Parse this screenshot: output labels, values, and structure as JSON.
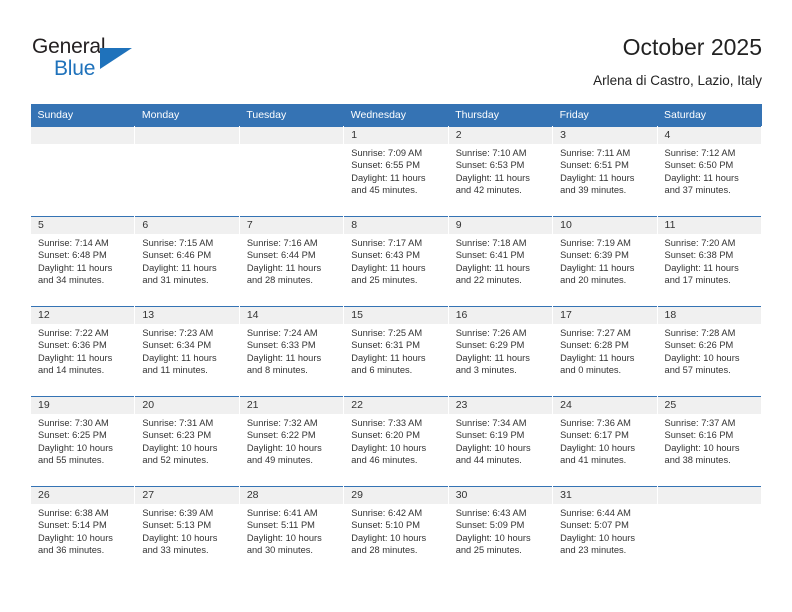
{
  "brand": {
    "name_part1": "General",
    "name_part2": "Blue",
    "accent_color": "#1f72bb",
    "triangle_icon": "triangle-logo-icon"
  },
  "header": {
    "title": "October 2025",
    "subtitle": "Arlena di Castro, Lazio, Italy"
  },
  "calendar": {
    "header_bg": "#3573b4",
    "daynum_bg": "#f0f0f0",
    "weekdays": [
      "Sunday",
      "Monday",
      "Tuesday",
      "Wednesday",
      "Thursday",
      "Friday",
      "Saturday"
    ],
    "labels": {
      "sunrise": "Sunrise:",
      "sunset": "Sunset:",
      "daylight": "Daylight:"
    },
    "weeks": [
      [
        {
          "day": "",
          "empty": true
        },
        {
          "day": "",
          "empty": true
        },
        {
          "day": "",
          "empty": true
        },
        {
          "day": "1",
          "sunrise": "Sunrise: 7:09 AM",
          "sunset": "Sunset: 6:55 PM",
          "daylight1": "Daylight: 11 hours",
          "daylight2": "and 45 minutes."
        },
        {
          "day": "2",
          "sunrise": "Sunrise: 7:10 AM",
          "sunset": "Sunset: 6:53 PM",
          "daylight1": "Daylight: 11 hours",
          "daylight2": "and 42 minutes."
        },
        {
          "day": "3",
          "sunrise": "Sunrise: 7:11 AM",
          "sunset": "Sunset: 6:51 PM",
          "daylight1": "Daylight: 11 hours",
          "daylight2": "and 39 minutes."
        },
        {
          "day": "4",
          "sunrise": "Sunrise: 7:12 AM",
          "sunset": "Sunset: 6:50 PM",
          "daylight1": "Daylight: 11 hours",
          "daylight2": "and 37 minutes."
        }
      ],
      [
        {
          "day": "5",
          "sunrise": "Sunrise: 7:14 AM",
          "sunset": "Sunset: 6:48 PM",
          "daylight1": "Daylight: 11 hours",
          "daylight2": "and 34 minutes."
        },
        {
          "day": "6",
          "sunrise": "Sunrise: 7:15 AM",
          "sunset": "Sunset: 6:46 PM",
          "daylight1": "Daylight: 11 hours",
          "daylight2": "and 31 minutes."
        },
        {
          "day": "7",
          "sunrise": "Sunrise: 7:16 AM",
          "sunset": "Sunset: 6:44 PM",
          "daylight1": "Daylight: 11 hours",
          "daylight2": "and 28 minutes."
        },
        {
          "day": "8",
          "sunrise": "Sunrise: 7:17 AM",
          "sunset": "Sunset: 6:43 PM",
          "daylight1": "Daylight: 11 hours",
          "daylight2": "and 25 minutes."
        },
        {
          "day": "9",
          "sunrise": "Sunrise: 7:18 AM",
          "sunset": "Sunset: 6:41 PM",
          "daylight1": "Daylight: 11 hours",
          "daylight2": "and 22 minutes."
        },
        {
          "day": "10",
          "sunrise": "Sunrise: 7:19 AM",
          "sunset": "Sunset: 6:39 PM",
          "daylight1": "Daylight: 11 hours",
          "daylight2": "and 20 minutes."
        },
        {
          "day": "11",
          "sunrise": "Sunrise: 7:20 AM",
          "sunset": "Sunset: 6:38 PM",
          "daylight1": "Daylight: 11 hours",
          "daylight2": "and 17 minutes."
        }
      ],
      [
        {
          "day": "12",
          "sunrise": "Sunrise: 7:22 AM",
          "sunset": "Sunset: 6:36 PM",
          "daylight1": "Daylight: 11 hours",
          "daylight2": "and 14 minutes."
        },
        {
          "day": "13",
          "sunrise": "Sunrise: 7:23 AM",
          "sunset": "Sunset: 6:34 PM",
          "daylight1": "Daylight: 11 hours",
          "daylight2": "and 11 minutes."
        },
        {
          "day": "14",
          "sunrise": "Sunrise: 7:24 AM",
          "sunset": "Sunset: 6:33 PM",
          "daylight1": "Daylight: 11 hours",
          "daylight2": "and 8 minutes."
        },
        {
          "day": "15",
          "sunrise": "Sunrise: 7:25 AM",
          "sunset": "Sunset: 6:31 PM",
          "daylight1": "Daylight: 11 hours",
          "daylight2": "and 6 minutes."
        },
        {
          "day": "16",
          "sunrise": "Sunrise: 7:26 AM",
          "sunset": "Sunset: 6:29 PM",
          "daylight1": "Daylight: 11 hours",
          "daylight2": "and 3 minutes."
        },
        {
          "day": "17",
          "sunrise": "Sunrise: 7:27 AM",
          "sunset": "Sunset: 6:28 PM",
          "daylight1": "Daylight: 11 hours",
          "daylight2": "and 0 minutes."
        },
        {
          "day": "18",
          "sunrise": "Sunrise: 7:28 AM",
          "sunset": "Sunset: 6:26 PM",
          "daylight1": "Daylight: 10 hours",
          "daylight2": "and 57 minutes."
        }
      ],
      [
        {
          "day": "19",
          "sunrise": "Sunrise: 7:30 AM",
          "sunset": "Sunset: 6:25 PM",
          "daylight1": "Daylight: 10 hours",
          "daylight2": "and 55 minutes."
        },
        {
          "day": "20",
          "sunrise": "Sunrise: 7:31 AM",
          "sunset": "Sunset: 6:23 PM",
          "daylight1": "Daylight: 10 hours",
          "daylight2": "and 52 minutes."
        },
        {
          "day": "21",
          "sunrise": "Sunrise: 7:32 AM",
          "sunset": "Sunset: 6:22 PM",
          "daylight1": "Daylight: 10 hours",
          "daylight2": "and 49 minutes."
        },
        {
          "day": "22",
          "sunrise": "Sunrise: 7:33 AM",
          "sunset": "Sunset: 6:20 PM",
          "daylight1": "Daylight: 10 hours",
          "daylight2": "and 46 minutes."
        },
        {
          "day": "23",
          "sunrise": "Sunrise: 7:34 AM",
          "sunset": "Sunset: 6:19 PM",
          "daylight1": "Daylight: 10 hours",
          "daylight2": "and 44 minutes."
        },
        {
          "day": "24",
          "sunrise": "Sunrise: 7:36 AM",
          "sunset": "Sunset: 6:17 PM",
          "daylight1": "Daylight: 10 hours",
          "daylight2": "and 41 minutes."
        },
        {
          "day": "25",
          "sunrise": "Sunrise: 7:37 AM",
          "sunset": "Sunset: 6:16 PM",
          "daylight1": "Daylight: 10 hours",
          "daylight2": "and 38 minutes."
        }
      ],
      [
        {
          "day": "26",
          "sunrise": "Sunrise: 6:38 AM",
          "sunset": "Sunset: 5:14 PM",
          "daylight1": "Daylight: 10 hours",
          "daylight2": "and 36 minutes."
        },
        {
          "day": "27",
          "sunrise": "Sunrise: 6:39 AM",
          "sunset": "Sunset: 5:13 PM",
          "daylight1": "Daylight: 10 hours",
          "daylight2": "and 33 minutes."
        },
        {
          "day": "28",
          "sunrise": "Sunrise: 6:41 AM",
          "sunset": "Sunset: 5:11 PM",
          "daylight1": "Daylight: 10 hours",
          "daylight2": "and 30 minutes."
        },
        {
          "day": "29",
          "sunrise": "Sunrise: 6:42 AM",
          "sunset": "Sunset: 5:10 PM",
          "daylight1": "Daylight: 10 hours",
          "daylight2": "and 28 minutes."
        },
        {
          "day": "30",
          "sunrise": "Sunrise: 6:43 AM",
          "sunset": "Sunset: 5:09 PM",
          "daylight1": "Daylight: 10 hours",
          "daylight2": "and 25 minutes."
        },
        {
          "day": "31",
          "sunrise": "Sunrise: 6:44 AM",
          "sunset": "Sunset: 5:07 PM",
          "daylight1": "Daylight: 10 hours",
          "daylight2": "and 23 minutes."
        },
        {
          "day": "",
          "empty": true
        }
      ]
    ]
  }
}
